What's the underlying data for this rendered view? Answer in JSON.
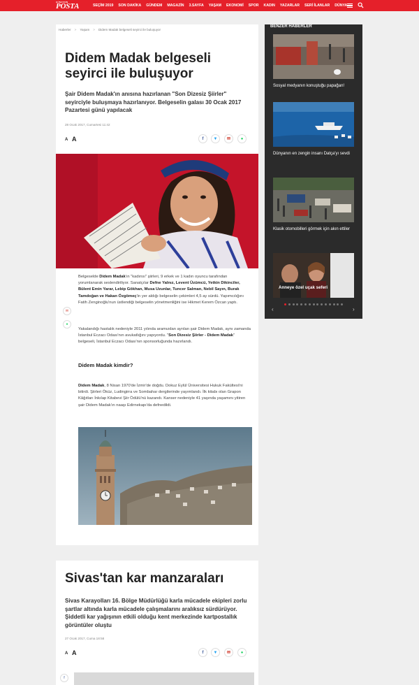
{
  "brand": {
    "logo_small": "GÜNAYDIN",
    "logo_text": "POSTA"
  },
  "nav": {
    "items": [
      "SEÇİM 2019",
      "SON DAKİKA",
      "GÜNDEM",
      "MAGAZİN",
      "3.SAYFA",
      "YAŞAM",
      "EKONOMİ",
      "SPOR",
      "KADIN",
      "YAZARLAR",
      "SERİ İLANLAR",
      "DÜNYA"
    ]
  },
  "article1": {
    "breadcrumb": [
      "Haberler",
      "Yaşam",
      "Didem Madak belgeseli seyirci ile buluşuyor"
    ],
    "title": "Didem Madak belgeseli seyirci ile buluşuyor",
    "spot": "Şair Didem Madak'ın anısına hazırlanan \"Son Dizesiz Şiirler\" seyirciyle buluşmaya hazırlanıyor. Belgeselin galası 30 Ocak 2017 Pazartesi günü yapılacak",
    "date": "28 Ocak 2017, Cumartesi 11:42",
    "font_small": "A",
    "font_big": "A",
    "p1_a": "Belgeselde ",
    "p1_b": "Didem Madak",
    "p1_c": "'ın \"kadınsı\" şiirleri, 9 erkek ve 1 kadın oyuncu tarafından yorumlanarak seslendiriliyor. Sanatçılar ",
    "p1_d": "Defne Yalnız, Levent Üzümcü, Yetkin Dikinciler, Bülent Emin Yarar, Lebip Gökhan, Musa Uzunlar, Tuncer Salman, Nebil Sayın, Burak Tamdoğan ve Hakan Özgömeç",
    "p1_e": "'in yer aldığı belgeselin çekimleri 4,5 ay sürdü. Yapımcılığını Fatih Zenginoğlu'nun üstlendiği belgeselin yönetmenliğini ise Hikmet Kerem Özcan yaptı.",
    "p2_a": "Yakalandığı hastalık nedeniyle 2011 yılında aramızdan ayrılan şair Didem Madak, aynı zamanda İstanbul Eczacı Odası'nın avukatlığını yapıyordu. \"",
    "p2_b": "Son Dizesiz Şiirler - Didem Madak",
    "p2_c": "\" belgeseli, İstanbul Eczacı Odası'nın sponsorluğunda hazırlandı.",
    "subhead": "Didem Madak kimdir?",
    "p3_a": "Didem Madak",
    "p3_b": ", 8 Nisan 1970'de İzmir'de doğdu. Dokuz Eylül Üniversitesi Hukuk Fakültesi'ni bitirdi. Şiirleri Öküz, Ludingirra ve Sombahar dergilerinde yayımlandı. İlk kitabı olan Grapon Kâğıtları İnkılap Kitabevi Şiir Ödülü'nü kazandı. Kanser nedeniyle 41 yaşında yaşamını yitiren şair Didem Madak'ın naaşı Edirnekapı'da defnedildi."
  },
  "sidebar": {
    "title": "BENZER HABERLER",
    "items": [
      {
        "caption": "Sosyal medyanın konuştuğu papağan!"
      },
      {
        "caption": "Dünyanın en zengin insanı Datça'yı sevdi"
      },
      {
        "caption": "Klasik otomobilleri görmek için akın ettiler"
      },
      {
        "caption": "Anneye özel uçak seferi"
      }
    ],
    "dots": 15,
    "active_dot": 0
  },
  "article2": {
    "title": "Sivas'tan kar manzaraları",
    "spot": "Sivas Karayolları 16. Bölge Müdürlüğü karla mücadele ekipleri zorlu şartlar altında karla mücadele çalışmalarını aralıksız sürdürüyor. Şiddetli kar yağışının etkili olduğu kent merkezinde kartpostallık görüntüler oluştu",
    "date": "27 Ocak 2017, Cuma 18:58",
    "font_small": "A",
    "font_big": "A"
  },
  "colors": {
    "brand_red": "#e5202a",
    "facebook": "#3b5998",
    "twitter": "#1da1f2",
    "mail": "#d13d2f",
    "whatsapp": "#25d366"
  }
}
